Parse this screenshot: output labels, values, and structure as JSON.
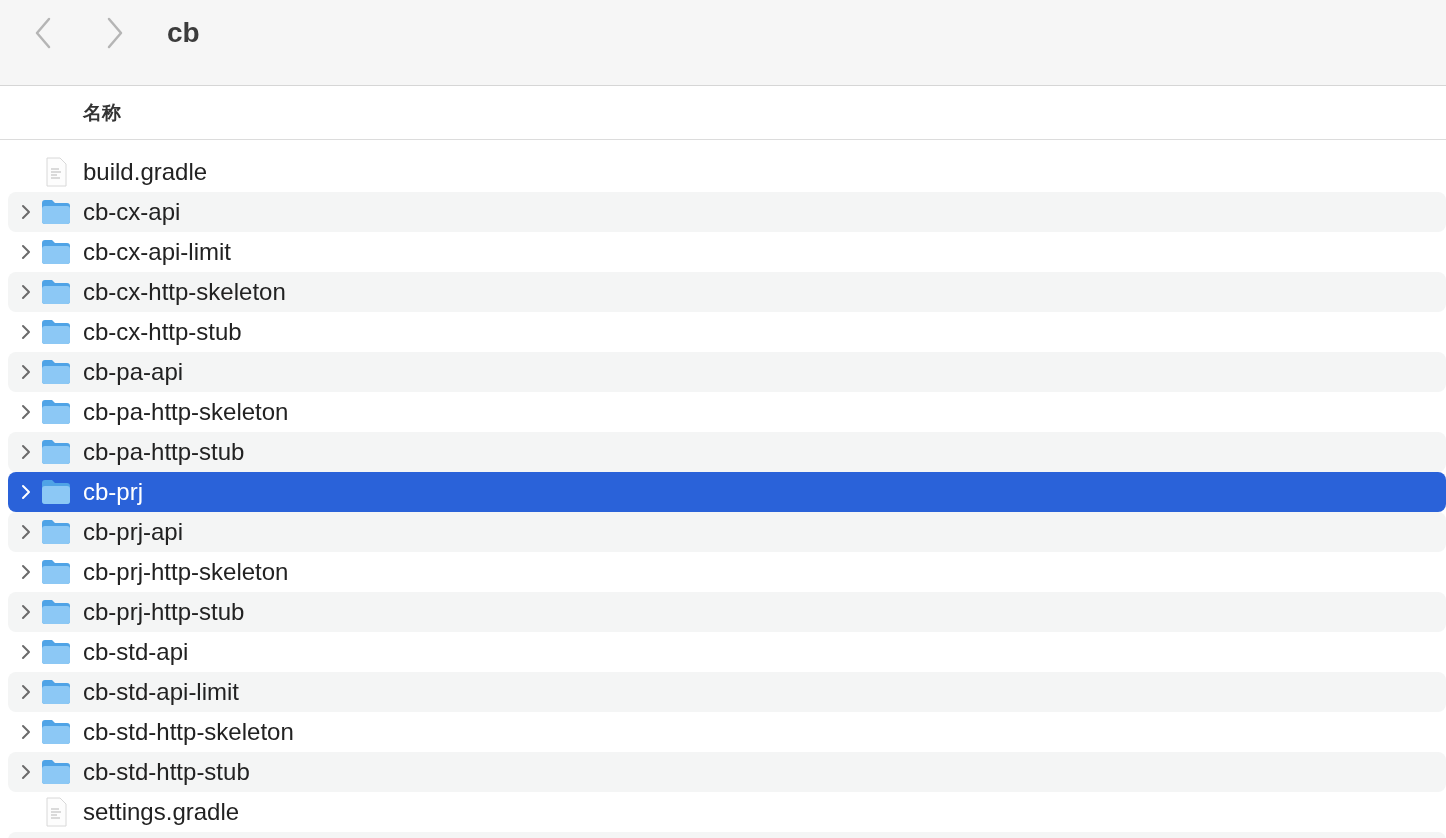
{
  "window": {
    "title": "cb"
  },
  "table": {
    "columns": [
      "名称"
    ],
    "rows": [
      {
        "name": "build.gradle",
        "kind": "file",
        "selected": false
      },
      {
        "name": "cb-cx-api",
        "kind": "folder",
        "selected": false
      },
      {
        "name": "cb-cx-api-limit",
        "kind": "folder",
        "selected": false
      },
      {
        "name": "cb-cx-http-skeleton",
        "kind": "folder",
        "selected": false
      },
      {
        "name": "cb-cx-http-stub",
        "kind": "folder",
        "selected": false
      },
      {
        "name": "cb-pa-api",
        "kind": "folder",
        "selected": false
      },
      {
        "name": "cb-pa-http-skeleton",
        "kind": "folder",
        "selected": false
      },
      {
        "name": "cb-pa-http-stub",
        "kind": "folder",
        "selected": false
      },
      {
        "name": "cb-prj",
        "kind": "folder",
        "selected": true
      },
      {
        "name": "cb-prj-api",
        "kind": "folder",
        "selected": false
      },
      {
        "name": "cb-prj-http-skeleton",
        "kind": "folder",
        "selected": false
      },
      {
        "name": "cb-prj-http-stub",
        "kind": "folder",
        "selected": false
      },
      {
        "name": "cb-std-api",
        "kind": "folder",
        "selected": false
      },
      {
        "name": "cb-std-api-limit",
        "kind": "folder",
        "selected": false
      },
      {
        "name": "cb-std-http-skeleton",
        "kind": "folder",
        "selected": false
      },
      {
        "name": "cb-std-http-stub",
        "kind": "folder",
        "selected": false
      },
      {
        "name": "settings.gradle",
        "kind": "file",
        "selected": false
      }
    ]
  }
}
